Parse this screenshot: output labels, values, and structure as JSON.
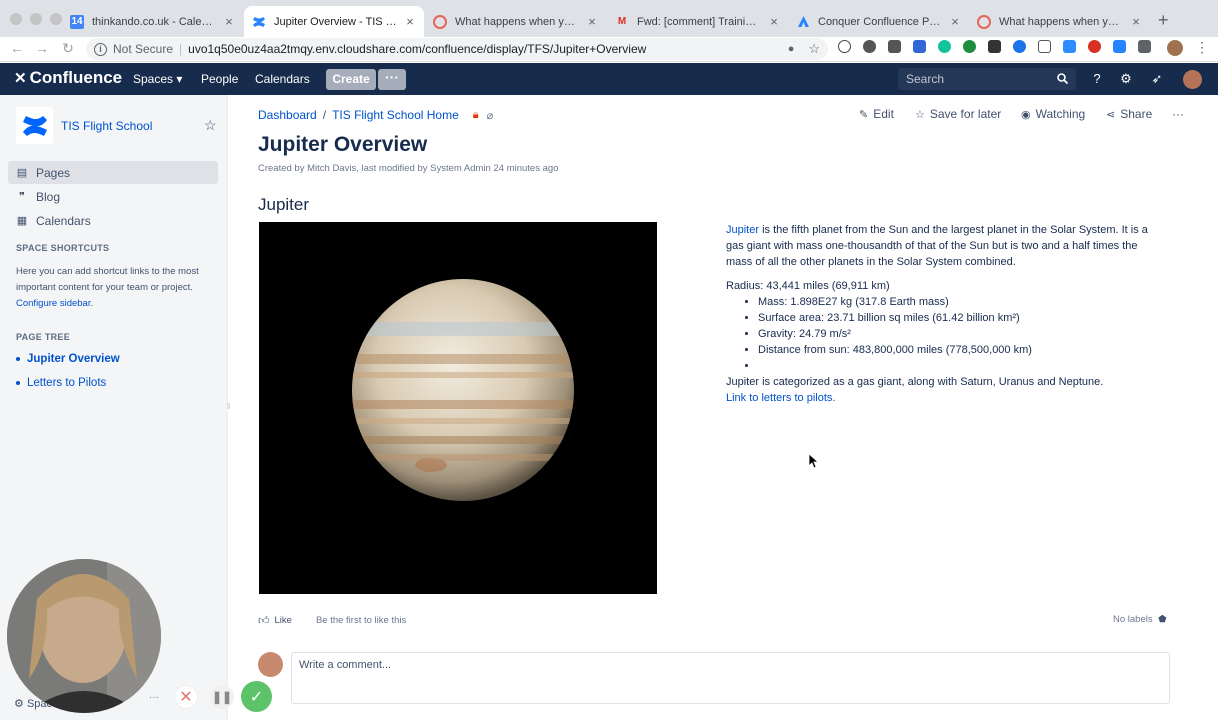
{
  "browser": {
    "tabs": [
      {
        "title": "thinkando.co.uk - Calendar -",
        "favicon": "google-calendar-icon",
        "favicon_text": "14",
        "active": false
      },
      {
        "title": "Jupiter Overview - TIS Flight",
        "favicon": "confluence-icon",
        "active": true
      },
      {
        "title": "What happens when you mo",
        "favicon": "lucidchart-icon",
        "active": false
      },
      {
        "title": "Fwd: [comment] Training & C",
        "favicon": "gmail-icon",
        "favicon_text": "M",
        "active": false
      },
      {
        "title": "Conquer Confluence Permiss",
        "favicon": "atlassian-icon",
        "active": false
      },
      {
        "title": "What happens when you mo",
        "favicon": "lucidchart-icon",
        "active": false
      }
    ],
    "security_label": "Not Secure",
    "url": "uvo1q50e0uz4aa2tmqy.env.cloudshare.com/confluence/display/TFS/Jupiter+Overview"
  },
  "nav": {
    "logo": "Confluence",
    "spaces": "Spaces",
    "people": "People",
    "calendars": "Calendars",
    "create": "Create",
    "more": "···",
    "search_placeholder": "Search"
  },
  "sidebar": {
    "space_name": "TIS Flight School",
    "items": [
      {
        "label": "Pages",
        "icon": "pages-icon",
        "selected": true
      },
      {
        "label": "Blog",
        "icon": "quote-icon",
        "selected": false
      },
      {
        "label": "Calendars",
        "icon": "calendar-icon",
        "selected": false
      }
    ],
    "shortcuts_heading": "SPACE SHORTCUTS",
    "shortcuts_text": "Here you can add shortcut links to the most important content for your team or project.",
    "configure_link": "Configure sidebar",
    "page_tree_heading": "PAGE TREE",
    "tree": [
      {
        "label": "Jupiter Overview",
        "current": true
      },
      {
        "label": "Letters to Pilots",
        "current": false
      }
    ],
    "space_tools": "Spac"
  },
  "page": {
    "breadcrumbs": [
      "Dashboard",
      "TIS Flight School Home"
    ],
    "actions": {
      "edit": "Edit",
      "save": "Save for later",
      "watching": "Watching",
      "share": "Share"
    },
    "title": "Jupiter Overview",
    "byline": "Created by Mitch Davis, last modified by System Admin 24 minutes ago",
    "section_heading": "Jupiter",
    "intro_link": "Jupiter",
    "intro_rest": " is the fifth planet from the Sun and the largest planet in the Solar System. It is a gas giant with mass one-thousandth of that of the Sun but is two and a half times the mass of all the other planets in the Solar System combined.",
    "radius": "Radius: 43,441 miles (69,911 km)",
    "facts": [
      "Mass: 1.898E27 kg (317.8 Earth mass)",
      "Surface area: 23.71 billion sq miles (61.42 billion km²)",
      "Gravity: 24.79 m/s²",
      "Distance from sun: 483,800,000 miles (778,500,000 km)",
      ""
    ],
    "category": "Jupiter is categorized as a gas giant, along with Saturn, Uranus and Neptune.",
    "letters_link": "Link to letters to pilots.",
    "like": "Like",
    "be_first": "Be the first to like this",
    "no_labels": "No labels",
    "comment_placeholder": "Write a comment..."
  },
  "colors": {
    "nav_bg": "#172b4d",
    "link": "#0052cc",
    "sidebar_bg": "#f4f5f7",
    "create_btn": "#a5adba"
  }
}
